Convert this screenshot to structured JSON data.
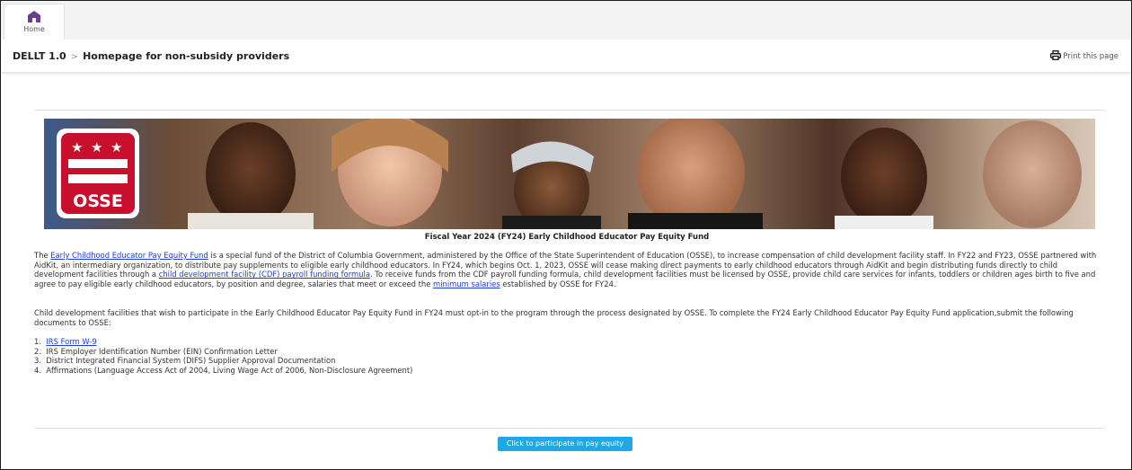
{
  "nav": {
    "home_label": "Home"
  },
  "header": {
    "app_name": "DELLT 1.0",
    "page_title": "Homepage for non-subsidy providers",
    "print_label": "Print this page"
  },
  "banner": {
    "logo_text": "OSSE"
  },
  "content": {
    "title": "Fiscal Year 2024 (FY24) Early Childhood Educator Pay Equity Fund",
    "p1_pre": "The ",
    "p1_link1": "Early Childhood Educator Pay Equity Fund",
    "p1_mid1": " is a special fund of the District of Columbia Government, administered by the Office of the State Superintendent of Education (OSSE), to increase compensation of child development facility staff. In FY22 and FY23, OSSE partnered with AidKit, an intermediary organization, to distribute pay supplements to eligible early childhood educators. In FY24, which begins Oct. 1, 2023, OSSE will cease making direct payments to early childhood educators through AidKit and begin  distributing funds directly to child development facilities through a ",
    "p1_link2": "child development facility (CDF) payroll funding formula",
    "p1_mid2": ". To receive funds from the CDF payroll funding formula, child development facilities must be licensed by OSSE, provide child care services  for infants, toddlers or children ages birth to five and agree to pay eligible early childhood educators, by position and degree, salaries that meet or exceed the ",
    "p1_link3": "minimum salaries",
    "p1_post": " established by OSSE for FY24.",
    "p2": "Child development facilities that wish to participate in the Early Childhood Educator Pay Equity Fund in FY24 must opt-in to the program through the process designated by OSSE. To complete the FY24 Early Childhood Educator Pay Equity Fund application,submit the following documents to OSSE:",
    "docs": [
      {
        "num": "1.",
        "text": "IRS Form W-9"
      },
      {
        "num": "2.",
        "text": "IRS Employer Identification Number (EIN) Confirmation Letter"
      },
      {
        "num": "3.",
        "text": "District Integrated Financial System (DIFS) Supplier Approval Documentation"
      },
      {
        "num": "4.",
        "text": "Affirmations (Language Access Act of 2004, Living Wage Act of 2006, Non-Disclosure Agreement)"
      }
    ],
    "cta_label": "Click to participate in pay equity"
  },
  "colors": {
    "accent_button": "#1fa7e6",
    "link": "#1a3fd6",
    "logo_red": "#c8102e",
    "nav_icon": "#6a3d8f"
  },
  "icons": {
    "home": "home-icon",
    "print": "printer-icon"
  }
}
